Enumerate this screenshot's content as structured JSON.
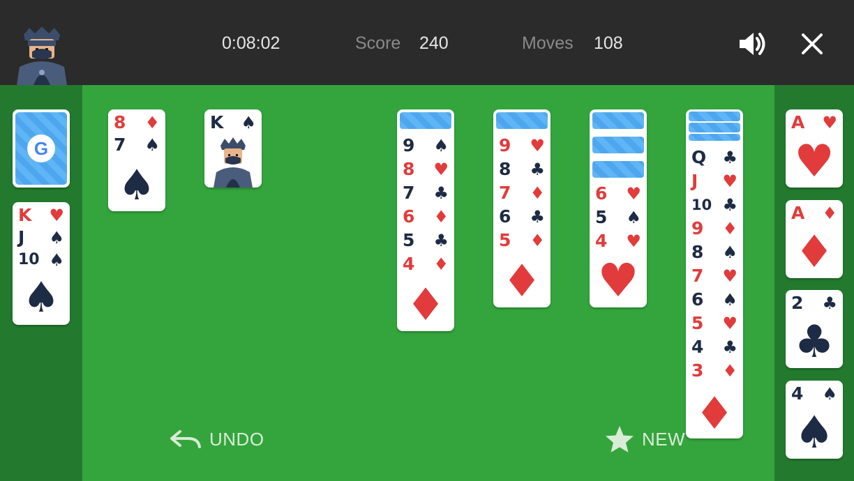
{
  "header": {
    "timer": "0:08:02",
    "score_label": "Score",
    "score_value": "240",
    "moves_label": "Moves",
    "moves_value": "108",
    "sound_icon": "speaker-icon",
    "close_icon": "close-icon"
  },
  "stock": {
    "back_logo": "G"
  },
  "waste": [
    {
      "rank": "K",
      "suit": "♥",
      "color": "red"
    },
    {
      "rank": "J",
      "suit": "♠",
      "color": "black"
    },
    {
      "rank": "10",
      "suit": "♠",
      "color": "black"
    }
  ],
  "columns": [
    {
      "face_down": 0,
      "cards": [
        {
          "rank": "8",
          "suit": "♦",
          "color": "red"
        },
        {
          "rank": "7",
          "suit": "♠",
          "color": "black"
        }
      ]
    },
    {
      "face_down": 0,
      "cards": [
        {
          "rank": "K",
          "suit": "♠",
          "color": "black"
        }
      ]
    },
    {
      "face_down": 0,
      "cards": []
    },
    {
      "face_down": 0,
      "cards": []
    },
    {
      "face_down": 1,
      "cards": [
        {
          "rank": "9",
          "suit": "♠",
          "color": "black"
        },
        {
          "rank": "8",
          "suit": "♥",
          "color": "red"
        },
        {
          "rank": "7",
          "suit": "♣",
          "color": "black"
        },
        {
          "rank": "6",
          "suit": "♦",
          "color": "red"
        },
        {
          "rank": "5",
          "suit": "♣",
          "color": "black"
        },
        {
          "rank": "4",
          "suit": "♦",
          "color": "red"
        }
      ]
    },
    {
      "face_down": 1,
      "cards": [
        {
          "rank": "9",
          "suit": "♥",
          "color": "red"
        },
        {
          "rank": "8",
          "suit": "♣",
          "color": "black"
        },
        {
          "rank": "7",
          "suit": "♦",
          "color": "red"
        },
        {
          "rank": "6",
          "suit": "♣",
          "color": "black"
        },
        {
          "rank": "5",
          "suit": "♦",
          "color": "red"
        }
      ]
    },
    {
      "face_down": 3,
      "cards": [
        {
          "rank": "6",
          "suit": "♥",
          "color": "red"
        },
        {
          "rank": "5",
          "suit": "♠",
          "color": "black"
        },
        {
          "rank": "4",
          "suit": "♥",
          "color": "red"
        }
      ]
    },
    {
      "face_down": 4,
      "cards": [
        {
          "rank": "Q",
          "suit": "♣",
          "color": "black"
        },
        {
          "rank": "J",
          "suit": "♥",
          "color": "red"
        },
        {
          "rank": "10",
          "suit": "♣",
          "color": "black"
        },
        {
          "rank": "9",
          "suit": "♦",
          "color": "red"
        },
        {
          "rank": "8",
          "suit": "♠",
          "color": "black"
        },
        {
          "rank": "7",
          "suit": "♥",
          "color": "red"
        },
        {
          "rank": "6",
          "suit": "♠",
          "color": "black"
        },
        {
          "rank": "5",
          "suit": "♥",
          "color": "red"
        },
        {
          "rank": "4",
          "suit": "♣",
          "color": "black"
        },
        {
          "rank": "3",
          "suit": "♦",
          "color": "red"
        }
      ]
    }
  ],
  "foundations": [
    {
      "rank": "A",
      "suit": "♥",
      "color": "red"
    },
    {
      "rank": "A",
      "suit": "♦",
      "color": "red"
    },
    {
      "rank": "2",
      "suit": "♣",
      "color": "black"
    },
    {
      "rank": "4",
      "suit": "♠",
      "color": "black"
    }
  ],
  "actions": {
    "undo_label": "UNDO",
    "new_label": "NEW"
  },
  "colors": {
    "felt": "#34a53d",
    "rail": "#237a2e",
    "header": "#2b2b2b",
    "red_suit": "#e23b3b",
    "black_suit": "#1d2b44",
    "card_back": "#5fb5f5"
  }
}
